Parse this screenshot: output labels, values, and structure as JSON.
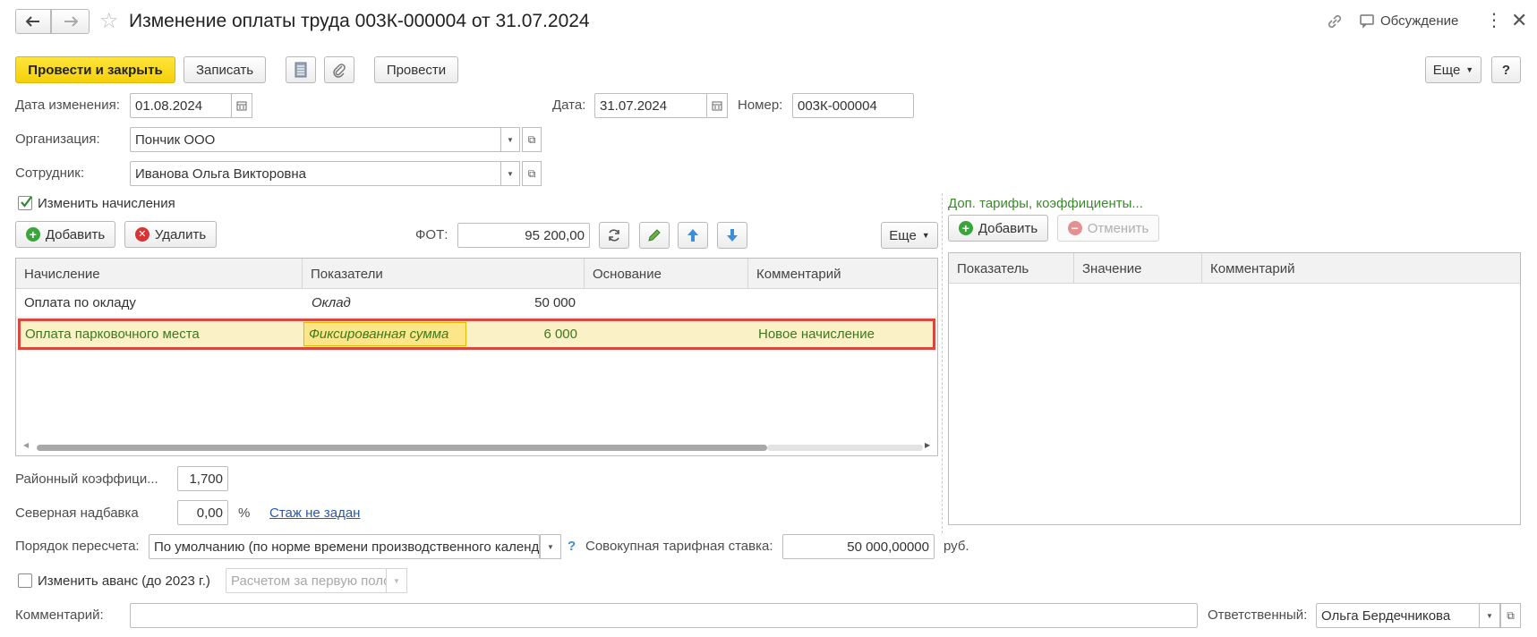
{
  "title": "Изменение оплаты труда 003К-000004 от 31.07.2024",
  "header": {
    "link_icon": "link-icon",
    "discussion_label": "Обсуждение",
    "more_icon": "more-vertical-icon",
    "close_icon": "close-icon"
  },
  "toolbar": {
    "post_close_label": "Провести и закрыть",
    "save_label": "Записать",
    "post_label": "Провести",
    "more_label": "Еще",
    "help_label": "?"
  },
  "fields": {
    "change_date_label": "Дата изменения:",
    "change_date_value": "01.08.2024",
    "date_label": "Дата:",
    "date_value": "31.07.2024",
    "number_label": "Номер:",
    "number_value": "003К-000004",
    "org_label": "Организация:",
    "org_value": "Пончик ООО",
    "employee_label": "Сотрудник:",
    "employee_value": "Иванова Ольга Викторовна"
  },
  "accruals": {
    "change_checkbox_label": "Изменить начисления",
    "change_checked": true,
    "add_label": "Добавить",
    "delete_label": "Удалить",
    "fot_label": "ФОТ:",
    "fot_value": "95 200,00",
    "more_label": "Еще",
    "columns": [
      "Начисление",
      "Показатели",
      "Основание",
      "Комментарий"
    ],
    "rows": [
      {
        "accrual": "Оплата по окладу",
        "indicator": "Оклад",
        "amount": "50 000",
        "basis": "",
        "comment": ""
      },
      {
        "accrual": "Оплата парковочного места",
        "indicator": "Фиксированная сумма",
        "amount": "6 000",
        "basis": "",
        "comment": "Новое начисление"
      }
    ]
  },
  "tariffs": {
    "title": "Доп. тарифы, коэффициенты...",
    "add_label": "Добавить",
    "cancel_label": "Отменить",
    "columns": [
      "Показатель",
      "Значение",
      "Комментарий"
    ]
  },
  "bottom": {
    "district_label": "Районный коэффици...",
    "district_value": "1,700",
    "north_label": "Северная надбавка",
    "north_value": "0,00",
    "percent": "%",
    "experience_link": "Стаж не задан",
    "recalc_label": "Порядок пересчета:",
    "recalc_value": "По умолчанию (по норме времени производственного календ",
    "recalc_help": "?",
    "rate_label": "Совокупная тарифная ставка:",
    "rate_value": "50 000,00000",
    "rate_unit": "руб.",
    "advance_label": "Изменить аванс (до 2023 г.)",
    "advance_checked": false,
    "advance_value": "Расчетом за первую поло",
    "comment_label": "Комментарий:",
    "comment_value": "",
    "responsible_label": "Ответственный:",
    "responsible_value": "Ольга Бердечникова"
  },
  "colors": {
    "accent_yellow": "#f5d00a",
    "selected_row": "#fbf1c7",
    "highlight_red": "#d9473f",
    "green_text": "#3a8a2a"
  }
}
